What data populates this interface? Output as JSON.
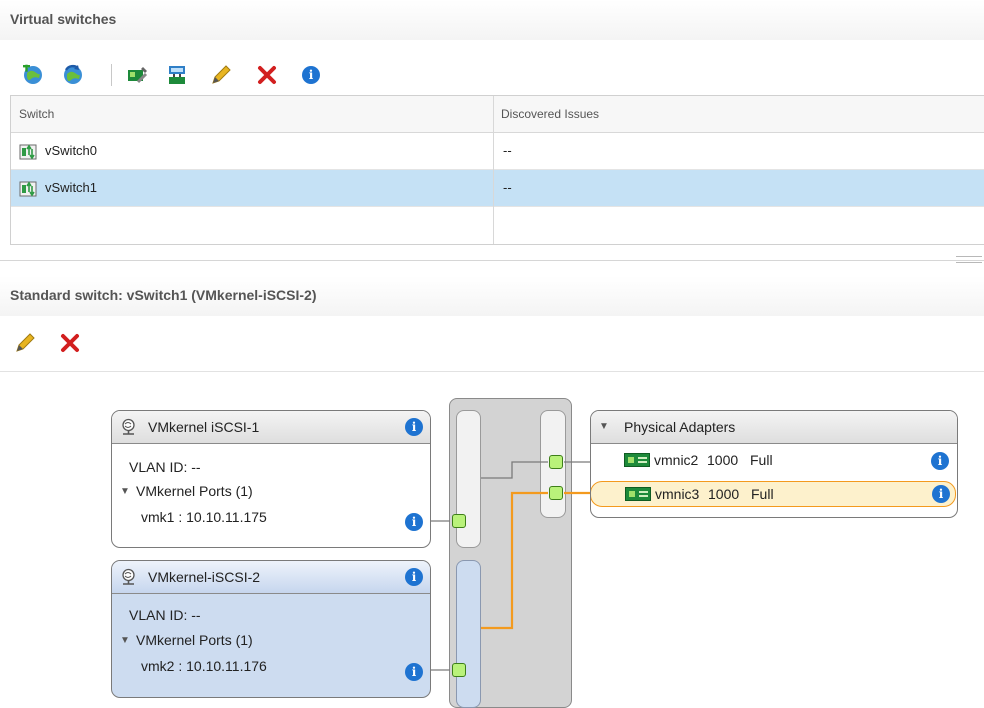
{
  "virtual_switches": {
    "title": "Virtual switches",
    "toolbar_icons": [
      "add-networking-icon",
      "refresh-icon",
      "manage-adapters-icon",
      "migrate-icon",
      "edit-icon",
      "remove-icon",
      "info-icon"
    ],
    "columns": [
      "Switch",
      "Discovered Issues"
    ],
    "rows": [
      {
        "name": "vSwitch0",
        "issues": "--",
        "selected": false
      },
      {
        "name": "vSwitch1",
        "issues": "--",
        "selected": true
      }
    ]
  },
  "standard_switch": {
    "title": "Standard switch: vSwitch1 (VMkernel-iSCSI-2)",
    "toolbar_icons": [
      "edit-icon",
      "remove-icon"
    ],
    "port_groups": [
      {
        "name": "VMkernel iSCSI-1",
        "vlan": "VLAN ID: --",
        "ports_label": "VMkernel Ports (1)",
        "port": "vmk1 : 10.10.11.175",
        "selected": false
      },
      {
        "name": "VMkernel-iSCSI-2",
        "vlan": "VLAN ID: --",
        "ports_label": "VMkernel Ports (1)",
        "port": "vmk2 : 10.10.11.176",
        "selected": true
      }
    ],
    "physical_adapters": {
      "title": "Physical Adapters",
      "items": [
        {
          "name": "vmnic2",
          "speed": "1000",
          "duplex": "Full",
          "selected": false
        },
        {
          "name": "vmnic3",
          "speed": "1000",
          "duplex": "Full",
          "selected": true
        }
      ]
    },
    "colors": {
      "accent": "#1e73d1",
      "active_link": "#f39a1e",
      "selection": "#c5e1f5"
    }
  }
}
